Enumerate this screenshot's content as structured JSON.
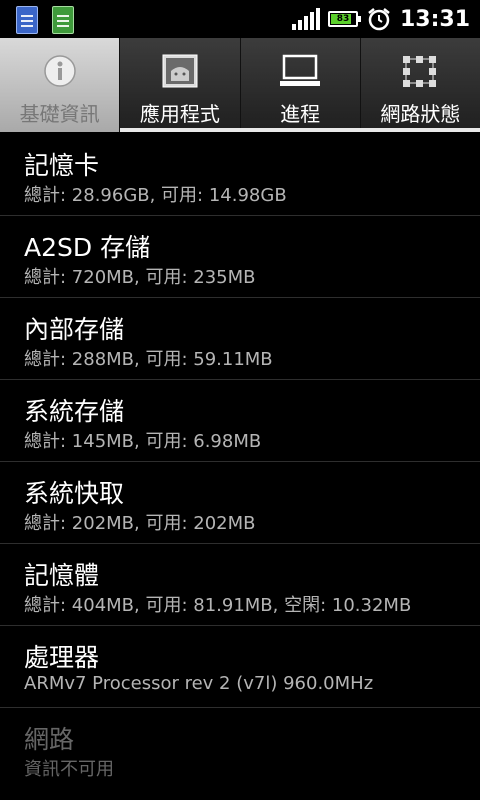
{
  "status_bar": {
    "notifications": [
      "notes-icon",
      "notes-icon"
    ],
    "battery_level": "83",
    "battery_fraction": 0.83,
    "time": "13:31"
  },
  "tabs": [
    {
      "label": "基礎資訊",
      "icon": "info-icon",
      "active": true
    },
    {
      "label": "應用程式",
      "icon": "apps-icon",
      "active": false
    },
    {
      "label": "進程",
      "icon": "process-icon",
      "active": false
    },
    {
      "label": "網路狀態",
      "icon": "network-icon",
      "active": false
    }
  ],
  "items": [
    {
      "title": "記憶卡",
      "detail": "總計: 28.96GB, 可用: 14.98GB"
    },
    {
      "title": "A2SD 存儲",
      "detail": "總計: 720MB, 可用: 235MB"
    },
    {
      "title": "內部存儲",
      "detail": "總計: 288MB, 可用: 59.11MB"
    },
    {
      "title": "系統存儲",
      "detail": "總計: 145MB, 可用: 6.98MB"
    },
    {
      "title": "系統快取",
      "detail": "總計: 202MB, 可用: 202MB"
    },
    {
      "title": "記憶體",
      "detail": "總計: 404MB, 可用: 81.91MB, 空閑: 10.32MB"
    },
    {
      "title": "處理器",
      "detail": "ARMv7 Processor rev 2 (v7l)  960.0MHz"
    },
    {
      "title": "網路",
      "detail": "資訊不可用"
    }
  ],
  "colors": {
    "accent_green": "#5cd02c",
    "tab_active": "#c8c8c8",
    "subtext": "#b5b5b5"
  }
}
